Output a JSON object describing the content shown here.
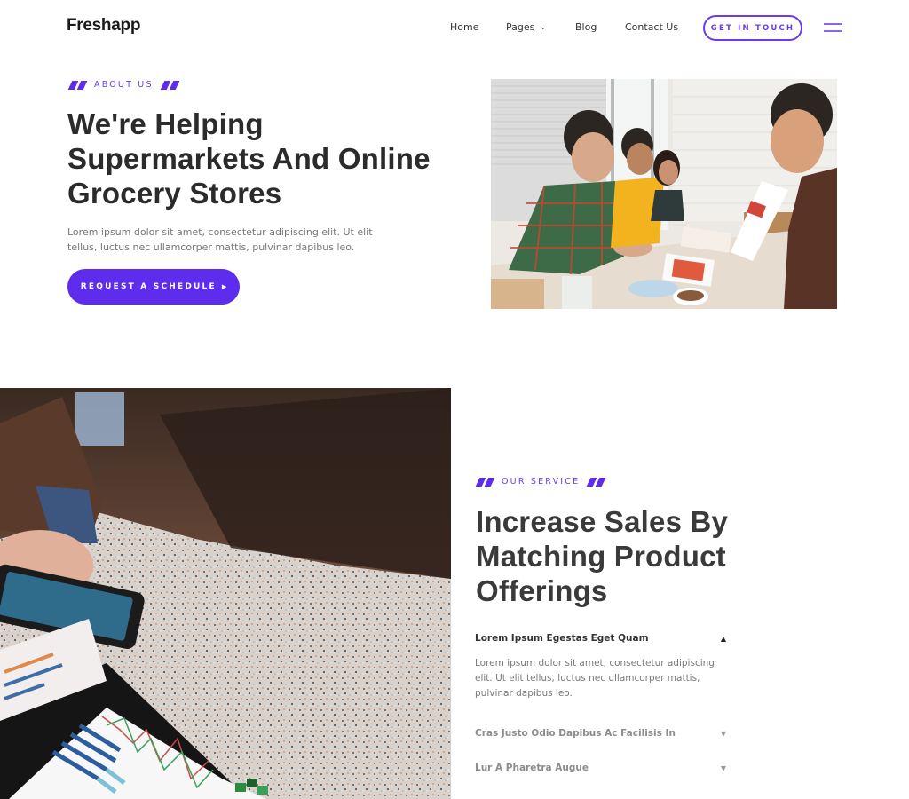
{
  "header": {
    "logo": "Freshapp",
    "nav": [
      {
        "label": "Home"
      },
      {
        "label": "Pages",
        "has_dropdown": true
      },
      {
        "label": "Blog"
      },
      {
        "label": "Contact Us"
      }
    ],
    "cta_label": "GET IN TOUCH",
    "menu_icon": "hamburger-icon"
  },
  "about": {
    "eyebrow": "ABOUT US",
    "title": "We're Helping Supermarkets And Online Grocery Stores",
    "description": "Lorem ipsum dolor sit amet, consectetur adipiscing elit. Ut elit tellus, luctus nec ullamcorper mattis, pulvinar dapibus leo.",
    "button_label": "REQUEST A SCHEDULE",
    "button_icon": "caret-right-icon",
    "image_alt": "Team of young colleagues smiling around a table reviewing app design printouts"
  },
  "service": {
    "eyebrow": "OUR SERVICE",
    "title": "Increase Sales By Matching Product Offerings",
    "image_alt": "Hand holding a smartphone over printed analytics charts on a speckled table",
    "accordion": [
      {
        "title": "Lorem Ipsum Egestas Eget Quam",
        "expanded": true,
        "body": "Lorem ipsum dolor sit amet, consectetur adipiscing elit. Ut elit tellus, luctus nec ullamcorper mattis, pulvinar dapibus leo."
      },
      {
        "title": "Cras Justo Odio Dapibus Ac Facilisis In",
        "expanded": false
      },
      {
        "title": "Lur A Pharetra Augue",
        "expanded": false
      }
    ]
  },
  "colors": {
    "accent": "#5e2ced",
    "accent_light": "#6c3bf0",
    "heading": "#2b2b2b",
    "body_text": "#777777"
  }
}
